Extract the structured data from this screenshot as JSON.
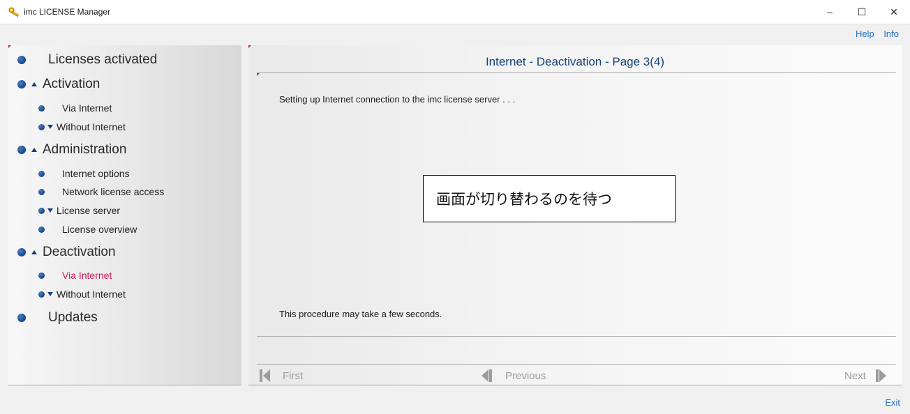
{
  "window": {
    "title": "imc LICENSE Manager",
    "minimize_glyph": "–",
    "maximize_glyph": "☐",
    "close_glyph": "✕"
  },
  "toplinks": {
    "help": "Help",
    "info": "Info"
  },
  "sidebar": {
    "items": [
      {
        "label": "Licenses activated",
        "level": 1
      },
      {
        "label": "Activation",
        "level": 1,
        "expander": "up"
      },
      {
        "label": "Via Internet",
        "level": 2
      },
      {
        "label": "Without Internet",
        "level": 2,
        "expander": "down"
      },
      {
        "label": "Administration",
        "level": 1,
        "expander": "up"
      },
      {
        "label": "Internet options",
        "level": 2
      },
      {
        "label": "Network license access",
        "level": 2
      },
      {
        "label": "License server",
        "level": 2,
        "expander": "down"
      },
      {
        "label": "License overview",
        "level": 2
      },
      {
        "label": "Deactivation",
        "level": 1,
        "expander": "up"
      },
      {
        "label": "Via Internet",
        "level": 2,
        "active": true
      },
      {
        "label": "Without Internet",
        "level": 2,
        "expander": "down"
      },
      {
        "label": "Updates",
        "level": 1
      }
    ]
  },
  "main": {
    "title": "Internet - Deactivation - Page 3(4)",
    "status_text": "Setting up Internet connection to the imc license server . . .",
    "overlay_note": "画面が切り替わるのを待つ",
    "footer_text": "This procedure may take a few seconds."
  },
  "nav": {
    "first": "First",
    "previous": "Previous",
    "next": "Next"
  },
  "exit": "Exit",
  "colors": {
    "accent_blue": "#14407a",
    "active_red": "#d4145a",
    "link_blue": "#1e6ec8",
    "disabled_gray": "#9c9c9c"
  }
}
